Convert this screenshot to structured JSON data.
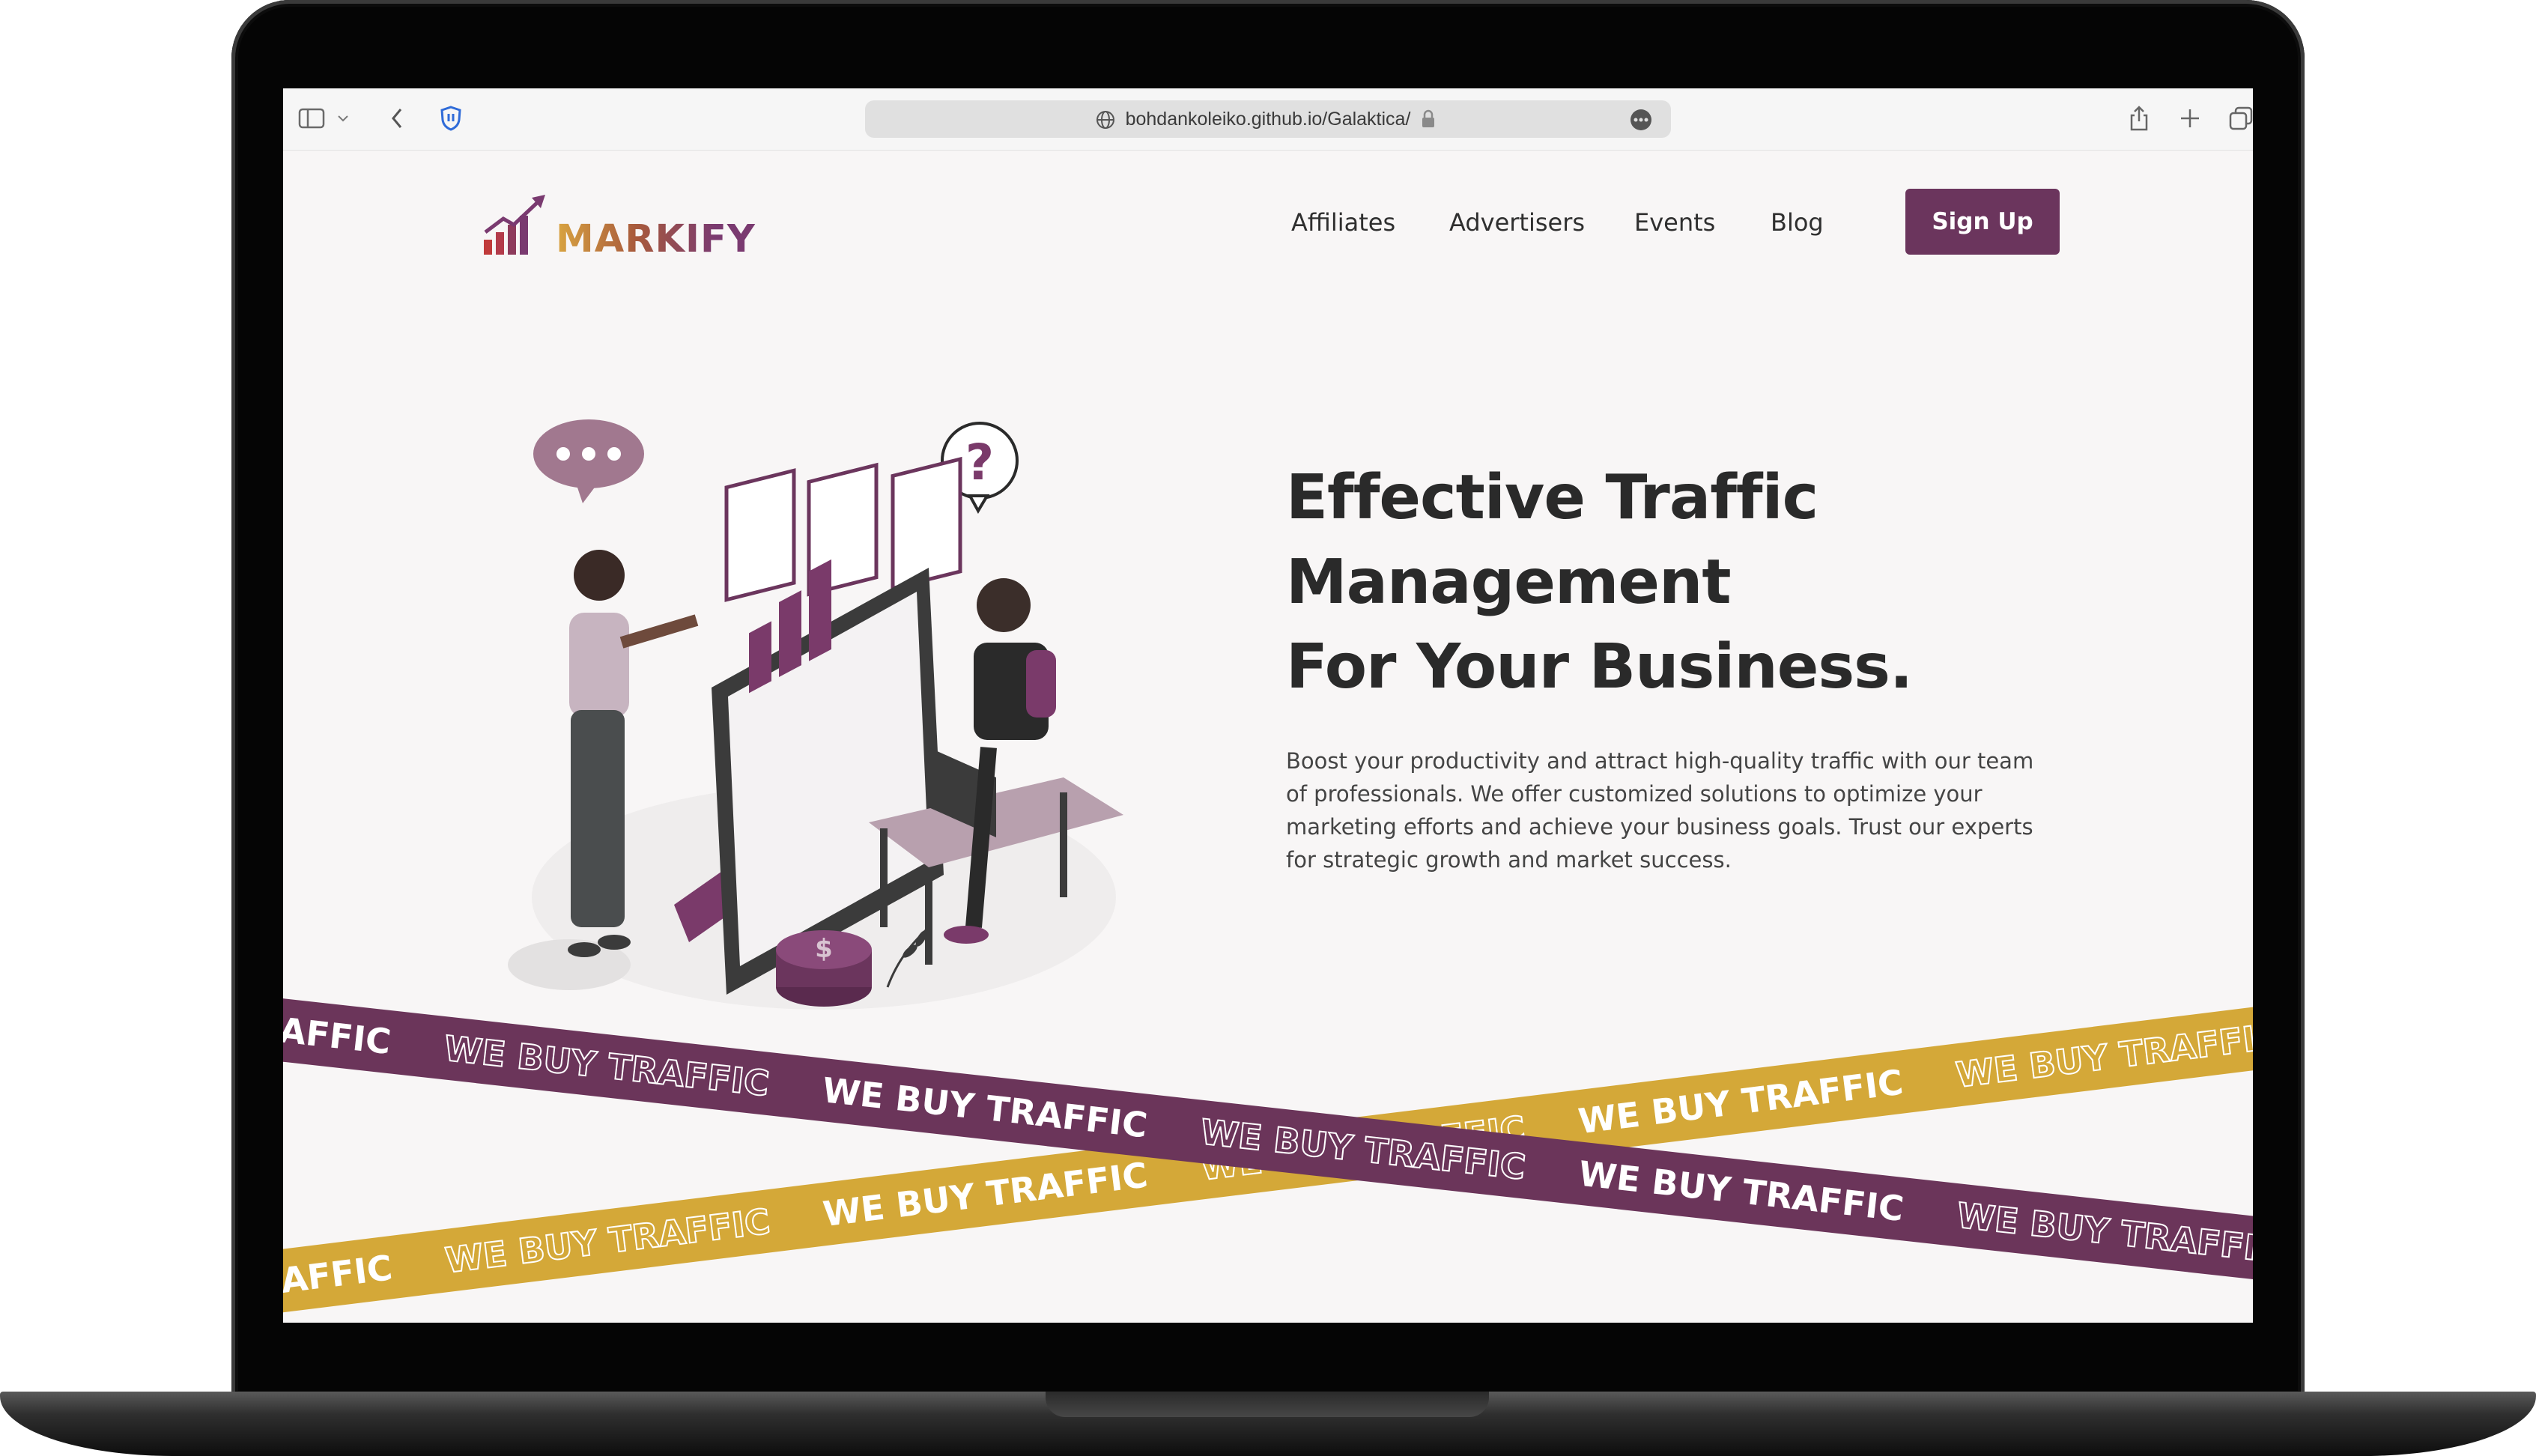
{
  "browser": {
    "url": "bohdankoleiko.github.io/Galaktica/"
  },
  "nav": {
    "logo_text": "MARKIFY",
    "links": [
      "Affiliates",
      "Advertisers",
      "Events",
      "Blog"
    ],
    "cta": "Sign Up"
  },
  "hero": {
    "title_line1": "Effective Traffic",
    "title_line2": "Management",
    "title_line3": "For Your Business.",
    "description": "Boost your productivity and attract high-quality traffic with our team of professionals. We offer customized solutions to optimize your marketing efforts and achieve your business goals. Trust our experts for strategic growth and market success."
  },
  "ribbons": {
    "text": "WE BUY TRAFFIC"
  },
  "colors": {
    "brand_purple": "#6b355d",
    "brand_gold": "#d4a838",
    "page_bg": "#f8f6f6"
  },
  "icons": [
    "sidebar-icon",
    "chevron-down-icon",
    "back-icon",
    "shield-icon",
    "globe-icon",
    "lock-icon",
    "more-icon",
    "share-icon",
    "plus-icon",
    "tabs-icon"
  ]
}
